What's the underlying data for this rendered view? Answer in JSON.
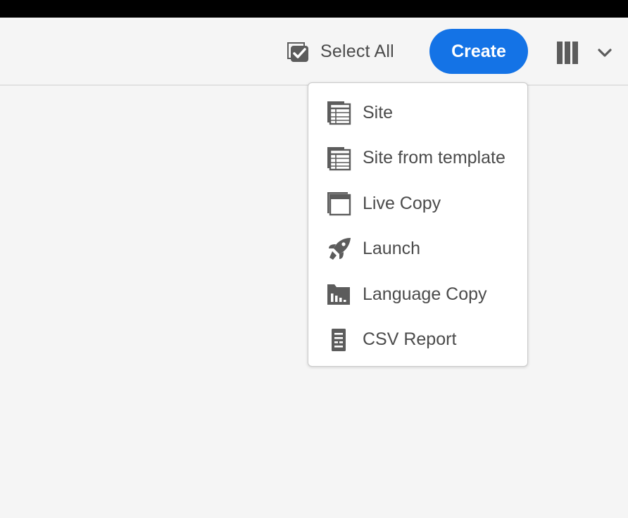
{
  "toolbar": {
    "select_all_label": "Select All",
    "select_all_icon": "checkbox-stack-icon",
    "create_label": "Create",
    "view_icon": "column-view-icon",
    "view_dropdown_icon": "chevron-down-icon"
  },
  "create_menu": {
    "items": [
      {
        "label": "Site",
        "icon": "site-icon"
      },
      {
        "label": "Site from template",
        "icon": "site-template-icon"
      },
      {
        "label": "Live Copy",
        "icon": "live-copy-icon"
      },
      {
        "label": "Launch",
        "icon": "rocket-icon"
      },
      {
        "label": "Language Copy",
        "icon": "language-copy-icon"
      },
      {
        "label": "CSV Report",
        "icon": "csv-report-icon"
      }
    ]
  },
  "colors": {
    "accent": "#1473e6",
    "text": "#4b4b4b",
    "background": "#f5f5f5",
    "top_bar": "#000000"
  }
}
